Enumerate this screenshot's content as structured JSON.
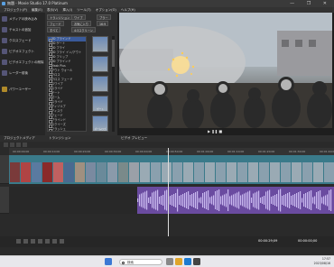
{
  "window": {
    "title": "無題 - Movie Studio 17.0 Platinum"
  },
  "menu": [
    "プロジェクト(P)",
    "編集(E)",
    "表示(V)",
    "挿入(I)",
    "ツール(T)",
    "オプション(O)",
    "ヘルプ(H)"
  ],
  "left_panel": [
    {
      "label": "メディアの読み込み",
      "icon": "media-import-icon"
    },
    {
      "label": "テキストの追加",
      "icon": "text-icon"
    },
    {
      "label": "クロスフェード",
      "icon": "crossfade-icon"
    },
    {
      "label": "ビデオエフェクト",
      "icon": "effects-icon"
    },
    {
      "label": "ビデオエフェクトの削除",
      "icon": "remove-effects-icon"
    },
    {
      "label": "レーダー前後",
      "icon": "radar-icon"
    },
    {
      "label": "パワーユーザー",
      "icon": "power-user-icon"
    }
  ],
  "fx_tabs": [
    "トランジション",
    "フェード",
    "ワイプ",
    "ブラー",
    "すべて",
    "お気に入り",
    "4:3スクリーン",
    "16:9"
  ],
  "fx_list": [
    "3D ブラインド",
    "3D ゲート",
    "3D フライ",
    "3D フライ イン/アウト",
    "3D フリップ",
    "3D ブラインド",
    "Mask Plus",
    "アウト ウォール",
    "クロス",
    "クロス フェード",
    "スワイプ",
    "スライド",
    "ゲート",
    "ズーム",
    "スライド",
    "ディゾルブ",
    "ディスク",
    "フェード",
    "ブラインド",
    "スクイーズ",
    "フラッシュ",
    "ページ カール",
    "ピース",
    "ワイプ"
  ],
  "fx_selected_index": 0,
  "thumbs": [
    "",
    "",
    "",
    "ゲート",
    "ズームロゴ"
  ],
  "labels": {
    "media": "プロジェクトメディア",
    "transitions": "トランジション",
    "preview": "ビデオ プレビュー"
  },
  "ruler": [
    "00:00:00;00",
    "00:00:10;00",
    "00:00:20;00",
    "00:00:30;00",
    "00:00:40;00",
    "00:00:50;00",
    "00:01:00;00",
    "00:01:10;00",
    "00:01:20;00",
    "00:01:30;00",
    "00:01:40;00"
  ],
  "transport": {
    "timecode": "00:00:29;09",
    "timecode2": "00:00:00;00"
  },
  "taskbar": {
    "search_placeholder": "検索",
    "time": "17:57",
    "date": "2023/08/16"
  },
  "colors": {
    "video_track": "#3a7a8a",
    "audio_track": "#6a4ba0",
    "accent": "#3a5a9a"
  }
}
